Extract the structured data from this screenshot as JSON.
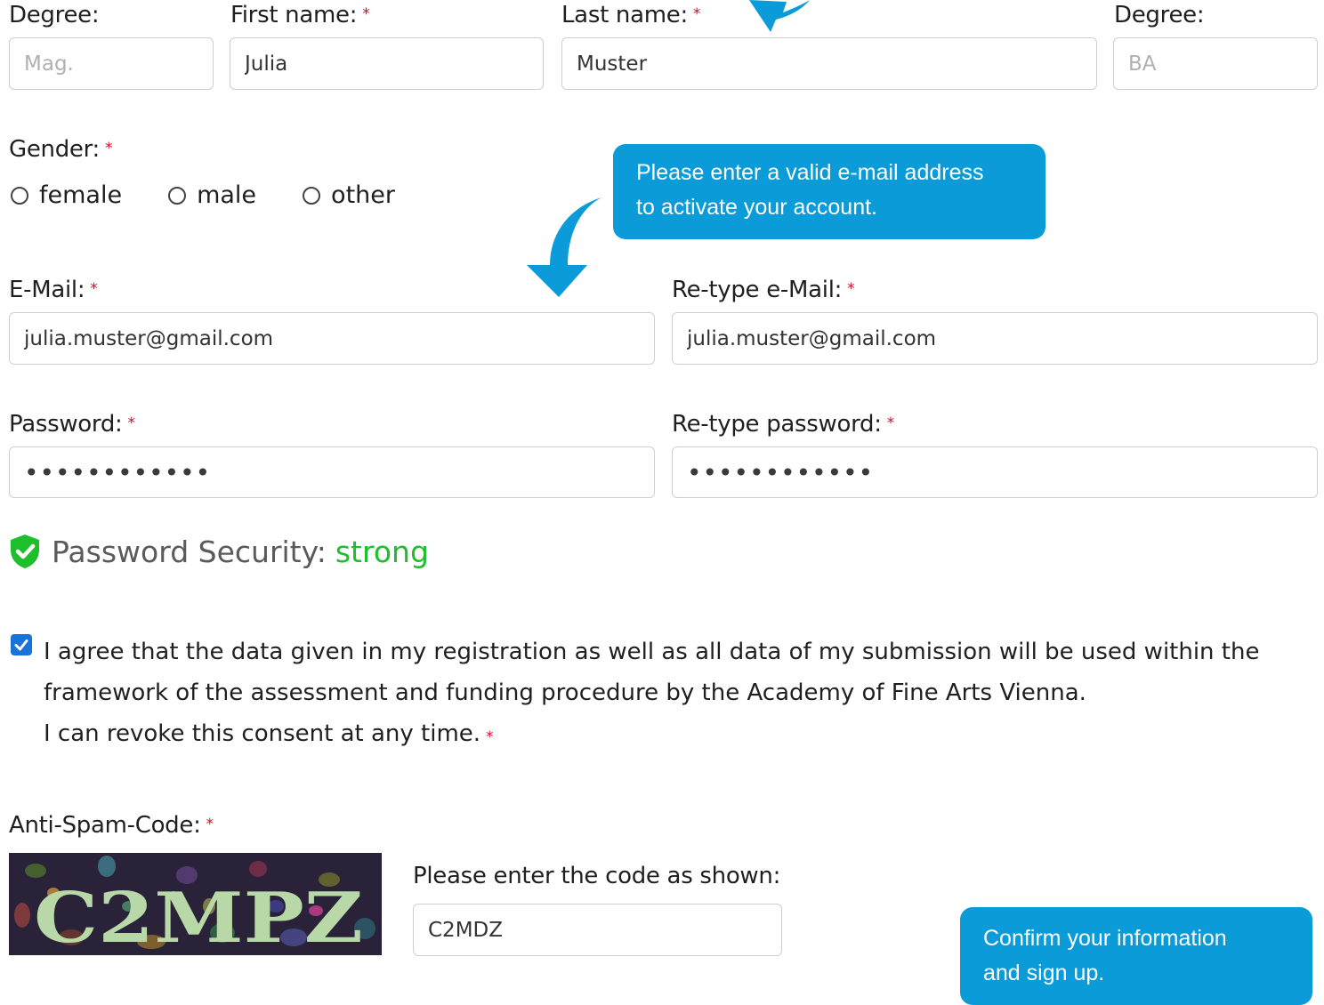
{
  "name_row": {
    "degree_pre": {
      "label": "Degree:",
      "placeholder": "Mag."
    },
    "first_name": {
      "label": "First name:",
      "value": "Julia"
    },
    "last_name": {
      "label": "Last name:",
      "value": "Muster"
    },
    "degree_post": {
      "label": "Degree:",
      "placeholder": "BA"
    }
  },
  "gender": {
    "label": "Gender:",
    "options": [
      "female",
      "male",
      "other"
    ]
  },
  "email": {
    "label": "E-Mail:",
    "value": "julia.muster@gmail.com",
    "retype_label": "Re-type e-Mail:",
    "retype_value": "julia.muster@gmail.com"
  },
  "password": {
    "label": "Password:",
    "value": "••••••••••••",
    "retype_label": "Re-type password:",
    "retype_value": "••••••••••••"
  },
  "password_security": {
    "label": "Password Security:",
    "value": "strong"
  },
  "consent": {
    "line1": "I agree that the data given in my registration as well as all data of my submission will be used within the",
    "line2": "framework of the assessment and funding procedure by the Academy of Fine Arts Vienna.",
    "line3": "I can revoke this consent at any time."
  },
  "antispam": {
    "label": "Anti-Spam-Code:",
    "captcha_text": "C2MPZ",
    "prompt": "Please enter the code as shown:",
    "value": "C2MDZ"
  },
  "required_marker": "*",
  "callouts": {
    "email_hint_line1": "Please enter a valid e-mail address",
    "email_hint_line2": "to activate your account.",
    "signup_hint_line1": "Confirm your information",
    "signup_hint_line2": "and sign up."
  },
  "colors": {
    "accent": "#0a9bd8",
    "required": "#c0142c",
    "strong": "#1fbf2b",
    "checkbox": "#1a73d9"
  }
}
